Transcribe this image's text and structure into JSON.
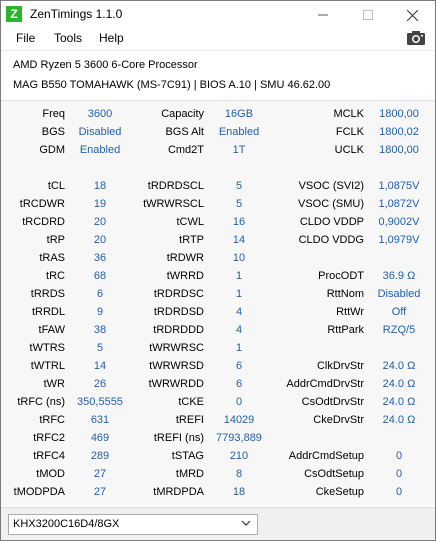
{
  "window": {
    "title": "ZenTimings 1.1.0",
    "icon_letter": "Z"
  },
  "menu": {
    "file": "File",
    "tools": "Tools",
    "help": "Help"
  },
  "system": {
    "cpu": "AMD Ryzen 5 3600 6-Core Processor",
    "board": "MAG B550 TOMAHAWK (MS-7C91) | BIOS A.10 | SMU 46.62.00"
  },
  "top": [
    [
      "Freq",
      "3600",
      "Capacity",
      "16GB",
      "MCLK",
      "1800,00"
    ],
    [
      "BGS",
      "Disabled",
      "BGS Alt",
      "Enabled",
      "FCLK",
      "1800,02"
    ],
    [
      "GDM",
      "Enabled",
      "Cmd2T",
      "1T",
      "UCLK",
      "1800,00"
    ]
  ],
  "timings": [
    [
      "tCL",
      "18",
      "tRDRDSCL",
      "5",
      "VSOC (SVI2)",
      "1,0875V"
    ],
    [
      "tRCDWR",
      "19",
      "tWRWRSCL",
      "5",
      "VSOC (SMU)",
      "1,0872V"
    ],
    [
      "tRCDRD",
      "20",
      "tCWL",
      "16",
      "CLDO VDDP",
      "0,9002V"
    ],
    [
      "tRP",
      "20",
      "tRTP",
      "14",
      "CLDO VDDG",
      "1,0979V"
    ],
    [
      "tRAS",
      "36",
      "tRDWR",
      "10",
      "",
      ""
    ],
    [
      "tRC",
      "68",
      "tWRRD",
      "1",
      "ProcODT",
      "36.9 Ω"
    ],
    [
      "tRRDS",
      "6",
      "tRDRDSC",
      "1",
      "RttNom",
      "Disabled"
    ],
    [
      "tRRDL",
      "9",
      "tRDRDSD",
      "4",
      "RttWr",
      "Off"
    ],
    [
      "tFAW",
      "38",
      "tRDRDDD",
      "4",
      "RttPark",
      "RZQ/5"
    ],
    [
      "tWTRS",
      "5",
      "tWRWRSC",
      "1",
      "",
      ""
    ],
    [
      "tWTRL",
      "14",
      "tWRWRSD",
      "6",
      "ClkDrvStr",
      "24.0 Ω"
    ],
    [
      "tWR",
      "26",
      "tWRWRDD",
      "6",
      "AddrCmdDrvStr",
      "24.0 Ω"
    ],
    [
      "tRFC (ns)",
      "350,5555",
      "tCKE",
      "0",
      "CsOdtDrvStr",
      "24.0 Ω"
    ],
    [
      "tRFC",
      "631",
      "tREFI",
      "14029",
      "CkeDrvStr",
      "24.0 Ω"
    ],
    [
      "tRFC2",
      "469",
      "tREFI (ns)",
      "7793,889",
      "",
      ""
    ],
    [
      "tRFC4",
      "289",
      "tSTAG",
      "210",
      "AddrCmdSetup",
      "0"
    ],
    [
      "tMOD",
      "27",
      "tMRD",
      "8",
      "CsOdtSetup",
      "0"
    ],
    [
      "tMODPDA",
      "27",
      "tMRDPDA",
      "18",
      "CkeSetup",
      "0"
    ]
  ],
  "profile": {
    "selected": "KHX3200C16D4/8GX"
  },
  "icons": {
    "minimize": "minimize-icon",
    "maximize": "maximize-icon",
    "close": "close-icon",
    "camera": "camera-icon",
    "chevron": "chevron-down-icon"
  }
}
